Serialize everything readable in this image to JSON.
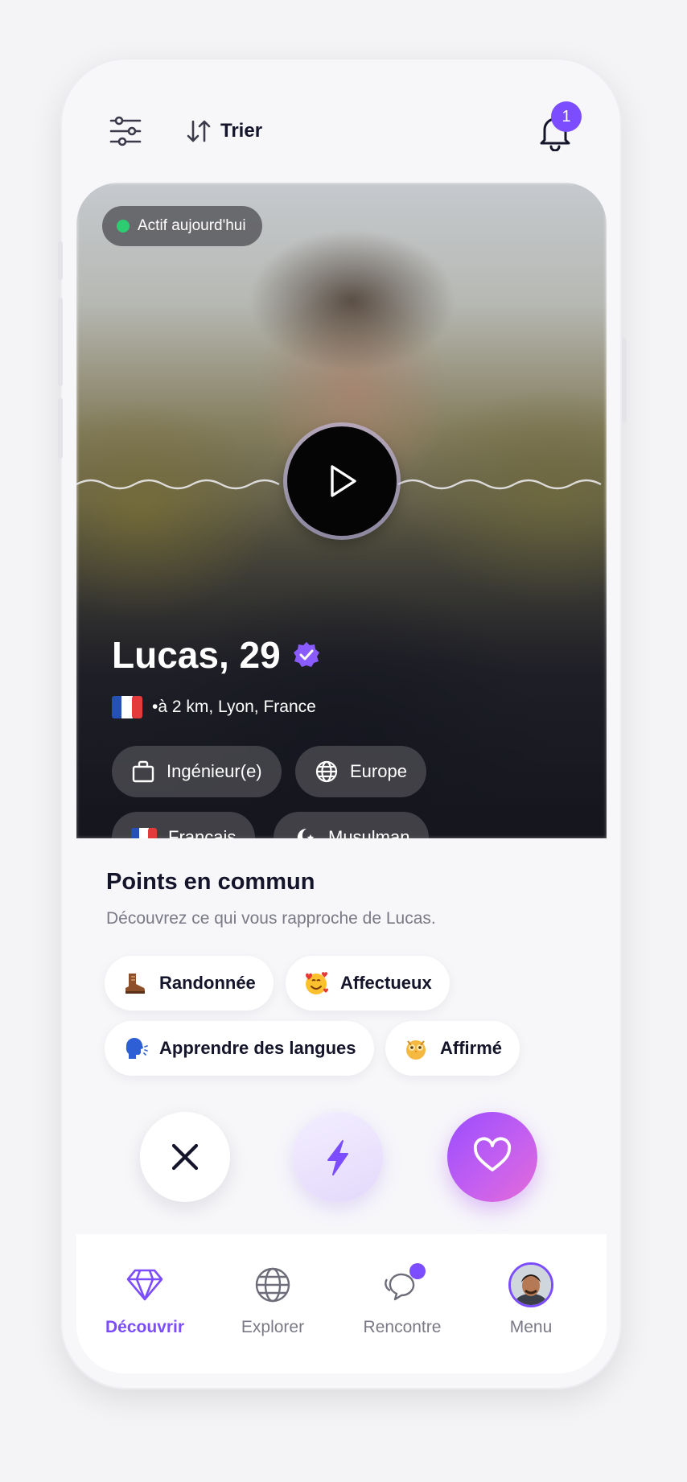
{
  "header": {
    "filter_icon": "sliders-icon",
    "sort_icon": "sort-arrows-icon",
    "sort_label": "Trier",
    "notification_icon": "bell-icon",
    "notification_count": "1"
  },
  "profile": {
    "status": "Actif aujourd'hui",
    "status_color": "#2ecc71",
    "name_age": "Lucas, 29",
    "verified_icon": "verified-badge-icon",
    "location": "•à 2 km, Lyon, France",
    "chips": [
      {
        "icon": "briefcase-icon",
        "label": "Ingénieur(e)"
      },
      {
        "icon": "globe-icon",
        "label": "Europe"
      },
      {
        "icon": "french-flag-icon",
        "label": "Français"
      },
      {
        "icon": "crescent-star-icon",
        "label": "Musulman"
      }
    ]
  },
  "common": {
    "title": "Points en commun",
    "subtitle": "Découvrez ce qui vous rapproche de Lucas.",
    "interests": [
      {
        "icon": "hiking-boot-icon",
        "label": "Randonnée"
      },
      {
        "icon": "smiling-face-hearts-icon",
        "label": "Affectueux"
      },
      {
        "icon": "speaking-head-icon",
        "label": "Apprendre des langues"
      },
      {
        "icon": "owl-icon",
        "label": "Affirmé"
      }
    ]
  },
  "actions": {
    "pass_icon": "close-icon",
    "boost_icon": "bolt-icon",
    "like_icon": "heart-icon"
  },
  "nav": [
    {
      "icon": "diamond-icon",
      "label": "Découvrir",
      "active": true
    },
    {
      "icon": "globe-icon",
      "label": "Explorer"
    },
    {
      "icon": "chat-bubbles-icon",
      "label": "Rencontre",
      "badge": true
    },
    {
      "icon": "avatar",
      "label": "Menu"
    }
  ],
  "colors": {
    "accent": "#7b4dff",
    "text_dark": "#14142b",
    "text_muted": "#7a7a86",
    "like_gradient_start": "#9a4dff",
    "like_gradient_end": "#e46bd8"
  }
}
